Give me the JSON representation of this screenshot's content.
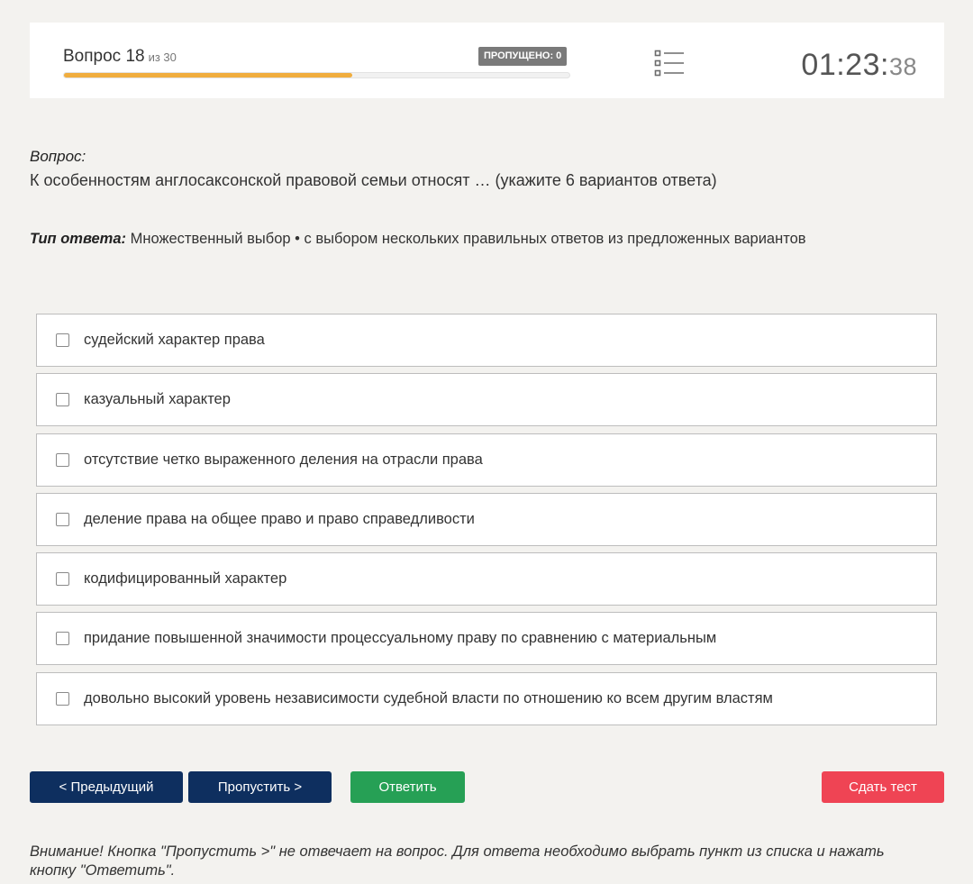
{
  "header": {
    "question_label": "Вопрос 18",
    "question_of": "из 30",
    "progress_percent": 57,
    "skipped_badge": "ПРОПУЩЕНО: 0",
    "timer_main": "01:23:",
    "timer_seconds": "38"
  },
  "question": {
    "label": "Вопрос:",
    "text": "К особенностям англосаксонской правовой семьи относят … (укажите 6 вариантов ответа)",
    "answer_type_label": "Тип ответа:",
    "answer_type_text": "Множественный выбор • с выбором нескольких правильных ответов из предложенных вариантов"
  },
  "options": [
    "судейский характер права",
    "казуальный характер",
    "отсутствие четко выраженного деления на отрасли права",
    "деление права на общее право и право справедливости",
    "кодифицированный характер",
    "придание повышенной значимости процессуальному праву по сравнению с материальным",
    "довольно высокий уровень независимости судебной власти по отношению ко всем другим властям"
  ],
  "buttons": {
    "prev": "< Предыдущий",
    "skip": "Пропустить >",
    "answer": "Ответить",
    "submit": "Сдать тест"
  },
  "warning": "Внимание! Кнопка \"Пропустить >\" не отвечает на вопрос. Для ответа необходимо выбрать пункт из списка и нажать кнопку \"Ответить\".",
  "colors": {
    "progress": "#f0ad3e",
    "nav_button": "#0e2f5f",
    "answer_button": "#26a055",
    "submit_button": "#ef4454"
  }
}
